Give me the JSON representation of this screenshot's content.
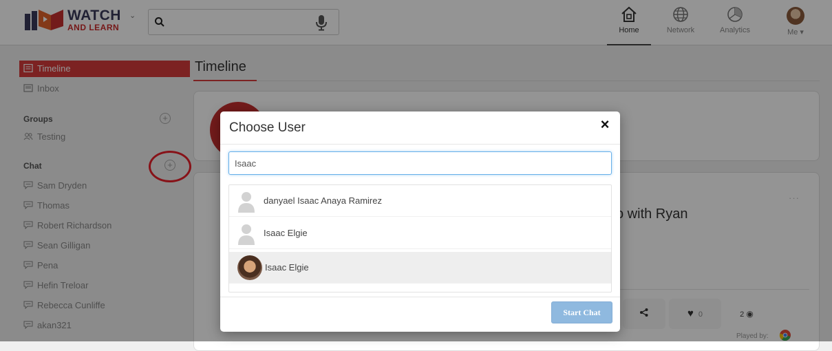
{
  "header": {
    "logo_line1": "WATCH",
    "logo_line2": "AND LEARN",
    "search_value": "",
    "nav": [
      {
        "label": "Home",
        "icon": "home-icon",
        "active": true
      },
      {
        "label": "Network",
        "icon": "globe-icon",
        "active": false
      },
      {
        "label": "Analytics",
        "icon": "pie-chart-icon",
        "active": false
      },
      {
        "label": "Me ▾",
        "icon": "avatar",
        "active": false
      }
    ]
  },
  "sidebar": {
    "items": [
      {
        "label": "Timeline",
        "active": true
      },
      {
        "label": "Inbox",
        "active": false
      }
    ],
    "groups_heading": "Groups",
    "groups": [
      "Testing"
    ],
    "chat_heading": "Chat",
    "chats": [
      "Sam Dryden",
      "Thomas",
      "Robert Richardson",
      "Sean Gilligan",
      "Pena",
      "Hefin Treloar",
      "Rebecca Cunliffe",
      "akan321"
    ]
  },
  "main": {
    "title": "Timeline",
    "post_title_fragment": "o with Ryan",
    "more_dots": "···",
    "likes": "0",
    "views": "2",
    "played_by": "Played by:"
  },
  "modal": {
    "title": "Choose User",
    "close": "×",
    "search_value": "Isaac",
    "results": [
      {
        "name": "danyael Isaac Anaya Ramirez",
        "has_photo": false,
        "selected": false
      },
      {
        "name": "Isaac Elgie",
        "has_photo": false,
        "selected": false
      },
      {
        "name": "Isaac Elgie",
        "has_photo": true,
        "selected": true
      }
    ],
    "start_button": "Start Chat"
  },
  "colors": {
    "accent_red": "#d63b3b",
    "annotation_ring": "#e8202a",
    "start_button": "#8fb9df"
  }
}
